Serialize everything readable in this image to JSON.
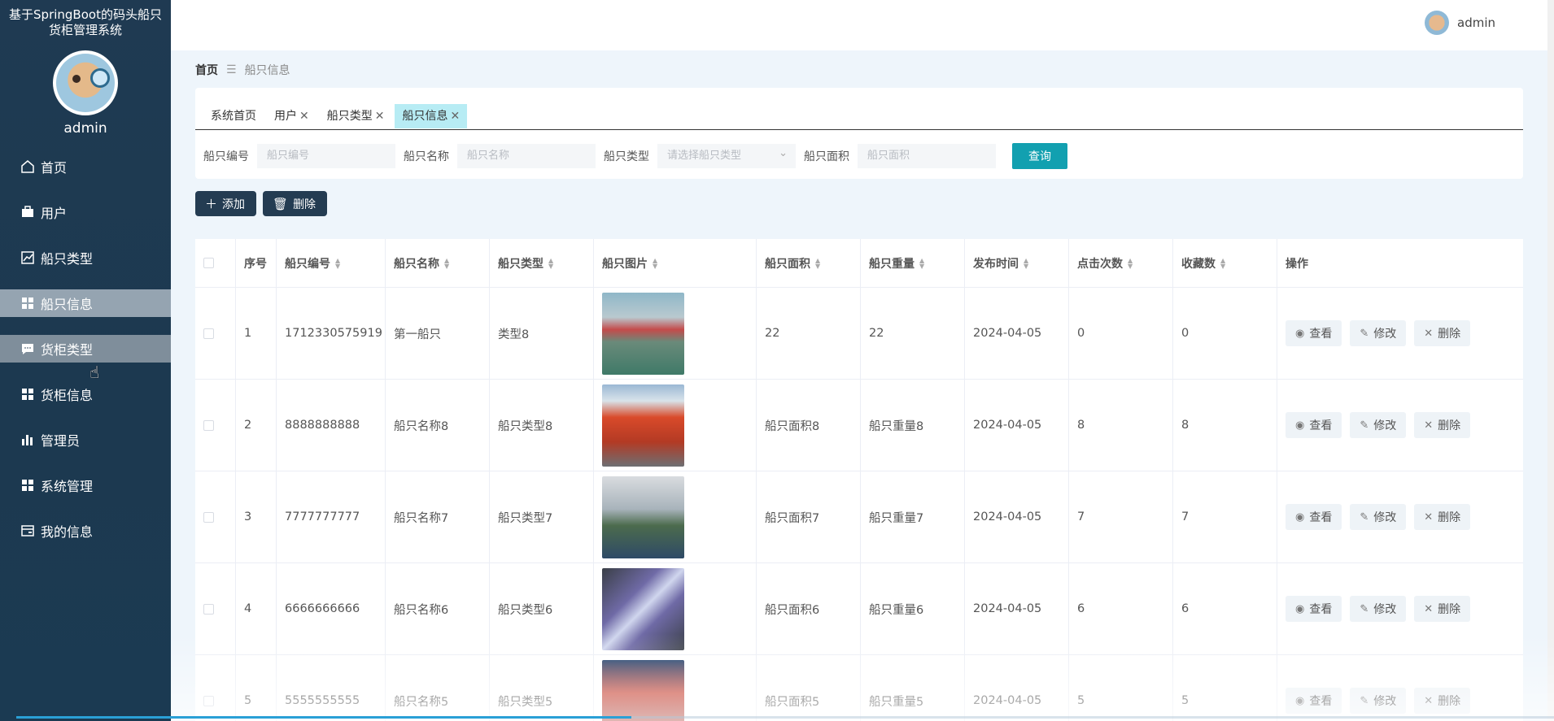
{
  "app": {
    "title": "基于SpringBoot的码头船只货柜管理系统",
    "title_line1": "基于SpringBoot的码头船只",
    "title_line2": "货柜管理系统"
  },
  "sidebar": {
    "username": "admin",
    "items": [
      {
        "label": "首页",
        "icon": "home-icon",
        "state": "normal"
      },
      {
        "label": "用户",
        "icon": "briefcase-icon",
        "state": "normal"
      },
      {
        "label": "船只类型",
        "icon": "chart-line-icon",
        "state": "normal"
      },
      {
        "label": "船只信息",
        "icon": "grid-icon",
        "state": "active"
      },
      {
        "label": "货柜类型",
        "icon": "message-icon",
        "state": "hover"
      },
      {
        "label": "货柜信息",
        "icon": "grid-icon",
        "state": "normal"
      },
      {
        "label": "管理员",
        "icon": "bar-chart-icon",
        "state": "normal"
      },
      {
        "label": "系统管理",
        "icon": "grid-icon",
        "state": "normal"
      },
      {
        "label": "我的信息",
        "icon": "wallet-icon",
        "state": "normal"
      }
    ]
  },
  "topbar": {
    "username": "admin"
  },
  "breadcrumb": {
    "home": "首页",
    "current": "船只信息"
  },
  "tabs": [
    {
      "label": "系统首页",
      "closable": false,
      "active": false
    },
    {
      "label": "用户",
      "closable": true,
      "active": false
    },
    {
      "label": "船只类型",
      "closable": true,
      "active": false
    },
    {
      "label": "船只信息",
      "closable": true,
      "active": true
    }
  ],
  "search": {
    "fields": [
      {
        "label": "船只编号",
        "placeholder": "船只编号"
      },
      {
        "label": "船只名称",
        "placeholder": "船只名称"
      },
      {
        "label": "船只类型",
        "placeholder": "请选择船只类型"
      },
      {
        "label": "船只面积",
        "placeholder": "船只面积"
      }
    ],
    "query_label": "查询"
  },
  "actions": {
    "add_label": "添加",
    "delete_label": "删除"
  },
  "table": {
    "headers": [
      "序号",
      "船只编号",
      "船只名称",
      "船只类型",
      "船只图片",
      "船只面积",
      "船只重量",
      "发布时间",
      "点击次数",
      "收藏数",
      "操作"
    ],
    "op_labels": {
      "view": "查看",
      "edit": "修改",
      "delete": "删除"
    },
    "rows": [
      {
        "index": "1",
        "code": "1712330575919",
        "name": "第一船只",
        "type": "类型8",
        "area": "22",
        "weight": "22",
        "date": "2024-04-05",
        "clicks": "0",
        "favorites": "0",
        "image": "port-cranes"
      },
      {
        "index": "2",
        "code": "8888888888",
        "name": "船只名称8",
        "type": "船只类型8",
        "area": "船只面积8",
        "weight": "船只重量8",
        "date": "2024-04-05",
        "clicks": "8",
        "favorites": "8",
        "image": "red-hull"
      },
      {
        "index": "3",
        "code": "7777777777",
        "name": "船只名称7",
        "type": "船只类型7",
        "area": "船只面积7",
        "weight": "船只重量7",
        "date": "2024-04-05",
        "clicks": "7",
        "favorites": "7",
        "image": "model-boat"
      },
      {
        "index": "4",
        "code": "6666666666",
        "name": "船只名称6",
        "type": "船只类型6",
        "area": "船只面积6",
        "weight": "船只重量6",
        "date": "2024-04-05",
        "clicks": "6",
        "favorites": "6",
        "image": "toy-ferries"
      },
      {
        "index": "5",
        "code": "5555555555",
        "name": "船只名称5",
        "type": "船只类型5",
        "area": "船只面积5",
        "weight": "船只重量5",
        "date": "2024-04-05",
        "clicks": "5",
        "favorites": "5",
        "image": "red-bow"
      }
    ]
  },
  "colors": {
    "sidebar": "#1f3a52",
    "accent": "#12a0b0",
    "active_tab": "#b7ecf4",
    "dark_button": "#243c52"
  },
  "video_progress": 0.4
}
